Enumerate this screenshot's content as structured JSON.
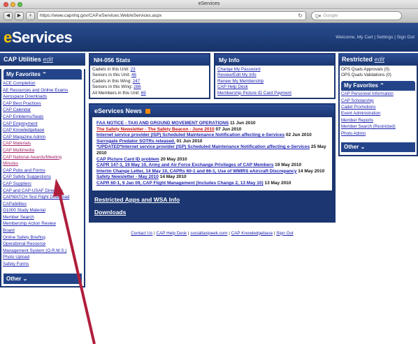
{
  "browser": {
    "window_title": "eServices",
    "url": "https://www.capnhq.gov/CAP.eServices.Web/eServices.aspx",
    "search_placeholder": "Google"
  },
  "header": {
    "logo": "Services",
    "welcome": "Welcome, My Cart | Settings | Sign Out"
  },
  "left": {
    "title": "CAP Utilities",
    "edit": "edit",
    "favorites_title": "My Favorites",
    "favorites": [
      "ACE Completion",
      "AE Resources and Online Exams",
      "Aerospace Downloads",
      "CAP Best Practices",
      "CAP Calendar",
      "CAP Emblems/Seals",
      "CAP Employment",
      "CAP Knowledgebase",
      "CAP Magazine Admin",
      "CAP Materials",
      "CAP Multimedia",
      "CAP National Awards/Meeting",
      "Minutes",
      "CAP Pubs and Forms",
      "CAP Safety Suggestions",
      "CAP Suppliers",
      "CAP and CAP-USAF Directory",
      "CAPWATCH Test Flight Download",
      "CAPabilities",
      "G1000 Study Material",
      "Member Search",
      "Membership Action Review",
      "Board",
      "Online Safety Briefing",
      "Operational Resource",
      "Management System (O.R.M.S.)",
      "Photo Upload",
      "Safety Forms"
    ],
    "other_title": "Other"
  },
  "stats": {
    "title": "NH-056 Stats",
    "rows": [
      {
        "label": "Cadets in this Unit:",
        "value": "23"
      },
      {
        "label": "Seniors in this Unit:",
        "value": "46"
      },
      {
        "label": "Cadets in this Wing:",
        "value": "247"
      },
      {
        "label": "Seniors in this Wing:",
        "value": "286"
      },
      {
        "label": "All Members in this Unit:",
        "value": "69"
      }
    ]
  },
  "myinfo": {
    "title": "My Info",
    "links": [
      "Change My Password",
      "Review/Edit My Info",
      "Renew My Membership",
      "CAP Help Desk",
      "Membership Picture ID Card Payment"
    ]
  },
  "news": {
    "title": "eServices News",
    "items": [
      {
        "link": "FAA NOTICE - TAXI AND GROUND MOVEMENT OPERATIONS",
        "date": "11 Jun 2010"
      },
      {
        "link": "The Safety Newsletter - The Safety Beacon - June 2010",
        "date": "07 Jun 2010"
      },
      {
        "link": "Internet service provider (ISP) Scheduled Maintenance Notification affecting e-Services",
        "date": "02 Jun 2010"
      },
      {
        "link": "Surrogate Predator SOTRs released.",
        "date": "01 Jun 2010"
      },
      {
        "link": "*UPDATED*Internet service provider (ISP) Scheduled Maintenance Notification affecting e-Services",
        "date": "25 May 2010"
      },
      {
        "link": "CAP Picture Card ID problem",
        "date": "20 May 2010"
      },
      {
        "link": "CAPR 147-1, 19 May 10, Army and Air Force Exchange Privileges of CAP Members",
        "date": "19 May 2010"
      },
      {
        "link": "Interim Change Letter, 14 May 10, CAPRs 60-1 and 66-1, Use of WMIRS eAircraft Discrepancy",
        "date": "14 May 2010"
      },
      {
        "link": "Safety Newsletter - May 2010",
        "date": "14 May 2010"
      },
      {
        "link": "CAPR 60-1, 9 Jan 09, CAP Flight Management (Includes Change 2, 13 May 10)",
        "date": "13 May 2010"
      }
    ],
    "restricted_link": "Restricted Apps and WSA Info",
    "downloads_link": "Downloads"
  },
  "footer": {
    "links": [
      "Contact Us",
      "CAP Help Desk",
      "socialtaxipeek.com",
      "CAP Knowledgebase",
      "Sign Out"
    ],
    "separator": "|"
  },
  "right": {
    "title": "Restricted",
    "edit": "edit",
    "lines": [
      "OPS Quals Approvals (0)",
      "OPS Quals Validations (0)"
    ],
    "favorites_title": "My Favorites",
    "favorites": [
      "CAP Personnel Information",
      "CAP Scholarship",
      "Cadet Promotions",
      "Event Administration",
      "Member Reports",
      "Member Search (Restricted)",
      "Photo Admin"
    ],
    "other_title": "Other"
  },
  "colors": {
    "panel_blue": "#1b3671",
    "annotation_arrow": "#b01e3c",
    "link": "#1a1fb0"
  }
}
